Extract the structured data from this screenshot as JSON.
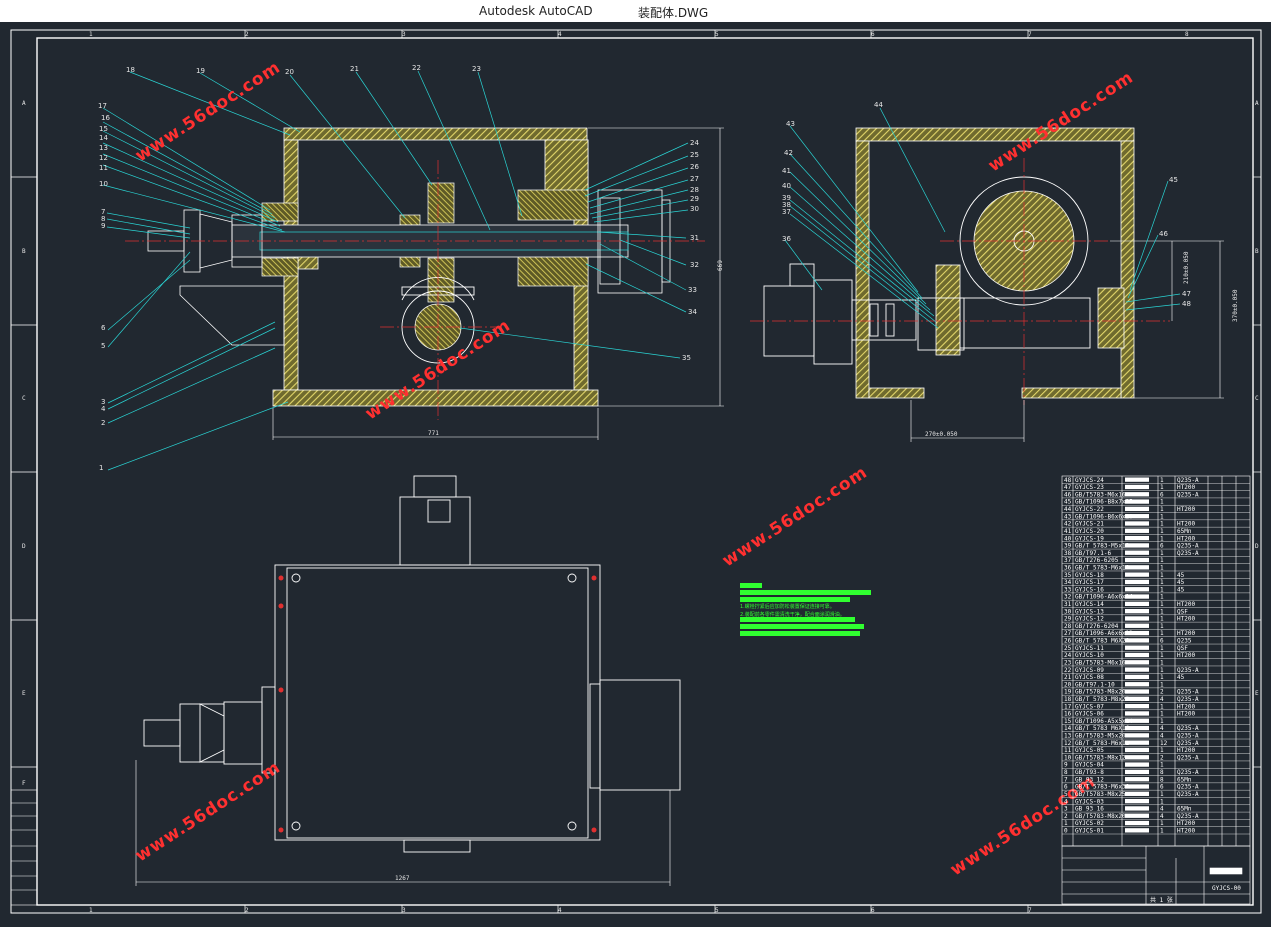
{
  "window": {
    "app_title": "Autodesk AutoCAD",
    "file_name": "装配体.DWG"
  },
  "frame": {
    "col_labels": [
      "1",
      "2",
      "3",
      "4",
      "5",
      "6",
      "7",
      "8"
    ],
    "row_labels": [
      "A",
      "B",
      "C",
      "D",
      "E",
      "F"
    ]
  },
  "callouts": {
    "front": [
      "18",
      "19",
      "20",
      "21",
      "22",
      "23",
      "17",
      "16",
      "15",
      "14",
      "13",
      "12",
      "11",
      "10",
      "7",
      "8",
      "9",
      "24",
      "25",
      "26",
      "27",
      "28",
      "29",
      "30",
      "31",
      "32",
      "33",
      "34",
      "35",
      "6",
      "5",
      "3",
      "4",
      "2",
      "1"
    ],
    "side": [
      "44",
      "43",
      "42",
      "41",
      "40",
      "39",
      "38",
      "37",
      "36",
      "45",
      "46",
      "47",
      "48"
    ]
  },
  "dimensions": {
    "front_width": "771",
    "front_height": "669",
    "plan_width": "1267",
    "side_width": "270±0.050",
    "side_height_a": "210±0.050",
    "side_height_b": "370±0.050"
  },
  "watermark": "www.56doc.com",
  "notes": [
    "1.螺栓拧紧后应加防松装置保证连接可靠。",
    "2.装配前各零件需清洗干净，配合面涂润滑油。"
  ],
  "bom": [
    [
      "48",
      "GYJCS-24",
      "1",
      "Q235-A"
    ],
    [
      "47",
      "GYJCS-23",
      "1",
      "HT200"
    ],
    [
      "46",
      "GB/T5783-M6x16",
      "6",
      "Q235-A"
    ],
    [
      "45",
      "GB/T1096-B8x7x25",
      "1",
      ""
    ],
    [
      "44",
      "GYJCS-22",
      "1",
      "HT200"
    ],
    [
      "43",
      "GB/T1096-B6x6x20",
      "1",
      ""
    ],
    [
      "42",
      "GYJCS-21",
      "1",
      "HT200"
    ],
    [
      "41",
      "GYJCS-20",
      "1",
      "65Mn"
    ],
    [
      "40",
      "GYJCS-19",
      "1",
      "HT200"
    ],
    [
      "39",
      "GB/T 5783-M5x12",
      "6",
      "Q235-A"
    ],
    [
      "38",
      "GB/T97.1-6",
      "1",
      "Q235-A"
    ],
    [
      "37",
      "GB/T276-6205",
      "1",
      ""
    ],
    [
      "36",
      "GB/T 5783-M6x10",
      "1",
      ""
    ],
    [
      "35",
      "GYJCS-18",
      "1",
      "45"
    ],
    [
      "34",
      "GYJCS-17",
      "1",
      "45"
    ],
    [
      "33",
      "GYJCS-16",
      "1",
      "45"
    ],
    [
      "32",
      "GB/T1096-A6x6x14",
      "1",
      ""
    ],
    [
      "31",
      "GYJCS-14",
      "1",
      "HT200"
    ],
    [
      "30",
      "GYJCS-13",
      "1",
      "QSF"
    ],
    [
      "29",
      "GYJCS-12",
      "1",
      "HT200"
    ],
    [
      "28",
      "GB/T276-6204",
      "1",
      ""
    ],
    [
      "27",
      "GB/T1096-A6x6x12",
      "1",
      "HT200"
    ],
    [
      "26",
      "GB/T 5783 M6X20",
      "6",
      "Q235"
    ],
    [
      "25",
      "GYJCS-11",
      "1",
      "QSF"
    ],
    [
      "24",
      "GYJCS-10",
      "1",
      "HT200"
    ],
    [
      "23",
      "GB/T5783-M6x16",
      "1",
      ""
    ],
    [
      "22",
      "GYJCS-09",
      "1",
      "Q235-A"
    ],
    [
      "21",
      "GYJCS-08",
      "1",
      "45"
    ],
    [
      "20",
      "GB/T97.1-10",
      "1",
      ""
    ],
    [
      "19",
      "GB/T5783-M8x20",
      "2",
      "Q235-A"
    ],
    [
      "18",
      "GB/T 5783-M8x25",
      "4",
      "Q235-A"
    ],
    [
      "17",
      "GYJCS-07",
      "1",
      "HT200"
    ],
    [
      "16",
      "GYJCS-06",
      "1",
      "HT200"
    ],
    [
      "15",
      "GB/T1096-A5x5x14",
      "1",
      ""
    ],
    [
      "14",
      "GB/T 5783 M6X16",
      "4",
      "Q235-A"
    ],
    [
      "13",
      "GB/T5783-M5x20",
      "4",
      "Q235-A"
    ],
    [
      "12",
      "GB/T 5783-M6x12",
      "12",
      "Q235-A"
    ],
    [
      "11",
      "GYJCS-05",
      "1",
      "HT200"
    ],
    [
      "10",
      "GB/T5783-M8x12",
      "2",
      "Q235-A"
    ],
    [
      "9",
      "GYJCS-04",
      "1",
      ""
    ],
    [
      "8",
      "GB/T93-8",
      "8",
      "Q235-A"
    ],
    [
      "7",
      "GB 93 12",
      "8",
      "65Mn"
    ],
    [
      "6",
      "GB/T 5783-M6x30",
      "6",
      "Q235-A"
    ],
    [
      "5",
      "GB/T5783-M8x25",
      "1",
      "Q235-A"
    ],
    [
      "4",
      "GYJCS-03",
      "1",
      ""
    ],
    [
      "3",
      "GB 93 16",
      "4",
      "65Mn"
    ],
    [
      "2",
      "GB/T5783-M8x20",
      "4",
      "Q235-A"
    ],
    [
      "1",
      "GYJCS-02",
      "1",
      "HT200"
    ],
    [
      "0",
      "GYJCS-01",
      "1",
      "HT200"
    ]
  ],
  "title_block": {
    "drawing_no": "GYJCS-00",
    "sheet": "共 1 张"
  },
  "colors": {
    "background": "#212830",
    "line": "#ffffff",
    "center": "#e03030",
    "hatch": "#d4c860",
    "leader": "#2ad4d4",
    "watermark": "#ff3030",
    "note": "#30ff30"
  }
}
